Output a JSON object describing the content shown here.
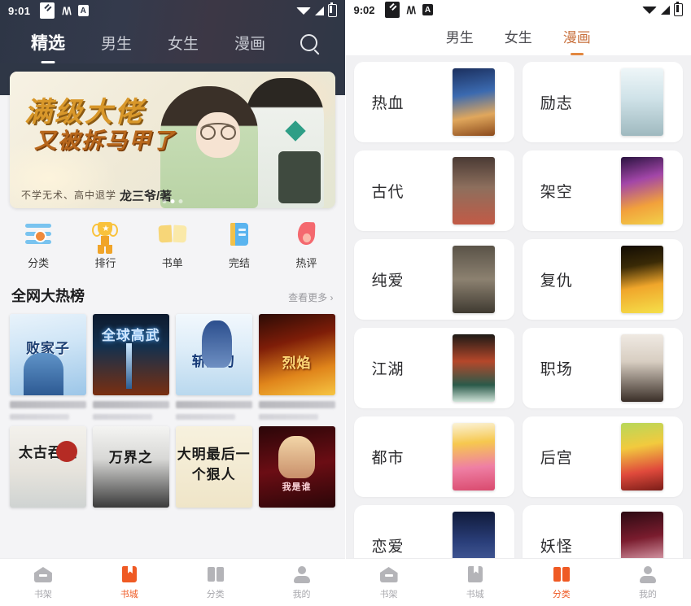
{
  "left": {
    "status": {
      "time": "9:01",
      "icons": [
        "note-icon",
        "messenger-icon",
        "app-a-icon",
        "wifi-icon",
        "signal-icon",
        "battery-icon"
      ]
    },
    "tabs": [
      {
        "label": "精选",
        "active": true
      },
      {
        "label": "男生",
        "active": false
      },
      {
        "label": "女生",
        "active": false
      },
      {
        "label": "漫画",
        "active": false
      }
    ],
    "search_icon": "search-icon",
    "banner": {
      "title_line1": "满级大佬",
      "title_line2": "又被拆马甲了",
      "subtitle": "不学无术、高中退学",
      "author": "龙三爷/著",
      "dots": 3,
      "active_dot": 1
    },
    "quick_actions": [
      {
        "label": "分类",
        "icon": "category-icon"
      },
      {
        "label": "排行",
        "icon": "trophy-icon"
      },
      {
        "label": "书单",
        "icon": "booklist-icon"
      },
      {
        "label": "完结",
        "icon": "completed-icon"
      },
      {
        "label": "热评",
        "icon": "hot-review-icon"
      }
    ],
    "section": {
      "title": "全网大热榜",
      "more_label": "查看更多",
      "more_chevron": "chevron-right-icon"
    },
    "books": [
      {
        "cover_text": "败家子",
        "cover_style": "cv1"
      },
      {
        "cover_text": "全球高武",
        "cover_style": "cv2"
      },
      {
        "cover_text": "斩天刃",
        "cover_style": "cv3"
      },
      {
        "cover_text": "烈焰",
        "cover_style": "cv4"
      },
      {
        "cover_text": "太古吞噬",
        "cover_style": "cv5"
      },
      {
        "cover_text": "万界之",
        "cover_style": "cv6"
      },
      {
        "cover_text": "大明最后一个狠人",
        "cover_style": "cv7"
      },
      {
        "cover_text": "我是谁",
        "cover_style": "cv8"
      }
    ],
    "bottom_nav": [
      {
        "label": "书架",
        "icon": "shelf-icon",
        "active": false
      },
      {
        "label": "书城",
        "icon": "store-icon",
        "active": true
      },
      {
        "label": "分类",
        "icon": "category-icon",
        "active": false
      },
      {
        "label": "我的",
        "icon": "profile-icon",
        "active": false
      }
    ]
  },
  "right": {
    "status": {
      "time": "9:02",
      "icons": [
        "note-icon",
        "messenger-icon",
        "app-a-icon",
        "wifi-icon",
        "signal-icon",
        "battery-icon"
      ]
    },
    "tabs": [
      {
        "label": "男生",
        "active": false
      },
      {
        "label": "女生",
        "active": false
      },
      {
        "label": "漫画",
        "active": true
      }
    ],
    "categories": [
      {
        "name": "热血",
        "thumb": "t1"
      },
      {
        "name": "励志",
        "thumb": "t2"
      },
      {
        "name": "古代",
        "thumb": "t3"
      },
      {
        "name": "架空",
        "thumb": "t4"
      },
      {
        "name": "纯爱",
        "thumb": "t5"
      },
      {
        "name": "复仇",
        "thumb": "t6"
      },
      {
        "name": "江湖",
        "thumb": "t7"
      },
      {
        "name": "职场",
        "thumb": "t8"
      },
      {
        "name": "都市",
        "thumb": "t9"
      },
      {
        "name": "后宫",
        "thumb": "t10"
      },
      {
        "name": "恋爱",
        "thumb": "t11"
      },
      {
        "name": "妖怪",
        "thumb": "t12"
      }
    ],
    "bottom_nav": [
      {
        "label": "书架",
        "icon": "shelf-icon",
        "active": false
      },
      {
        "label": "书城",
        "icon": "store-icon",
        "active": false
      },
      {
        "label": "分类",
        "icon": "category-icon",
        "active": true
      },
      {
        "label": "我的",
        "icon": "profile-icon",
        "active": false
      }
    ]
  },
  "colors": {
    "accent_orange": "#ef5a24",
    "tab_active_brown": "#c8703c",
    "dark_header": "#2f3746",
    "page_bg": "#f1f1f3"
  }
}
